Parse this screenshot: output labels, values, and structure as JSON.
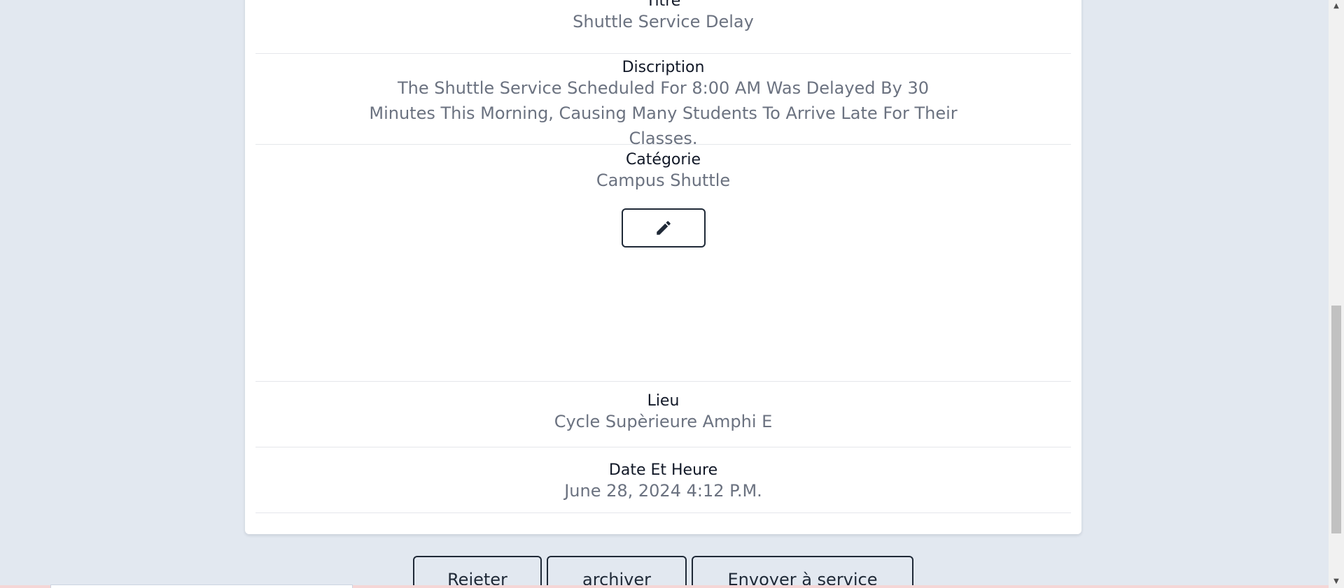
{
  "details": {
    "title": {
      "label": "Titre",
      "value": "Shuttle Service Delay"
    },
    "description": {
      "label": "Discription",
      "value": "The Shuttle Service Scheduled For 8:00 AM Was Delayed By 30 Minutes This Morning, Causing Many Students To Arrive Late For Their Classes."
    },
    "category": {
      "label": "Catégorie",
      "value": "Campus Shuttle",
      "edit_icon": "pencil-icon"
    },
    "location": {
      "label": "Lieu",
      "value": "Cycle Supèrieure Amphi E"
    },
    "datetime": {
      "label": "Date Et Heure",
      "value": "June 28, 2024 4:12 P.M."
    }
  },
  "actions": {
    "reject_label": "Rejeter",
    "archive_label": "archiver",
    "send_label": "Envoyer à service"
  },
  "colors": {
    "page_background": "#e2e8f0",
    "card_background": "#ffffff",
    "label_text": "#111827",
    "value_text": "#6b7280",
    "button_border": "#1f2937"
  }
}
